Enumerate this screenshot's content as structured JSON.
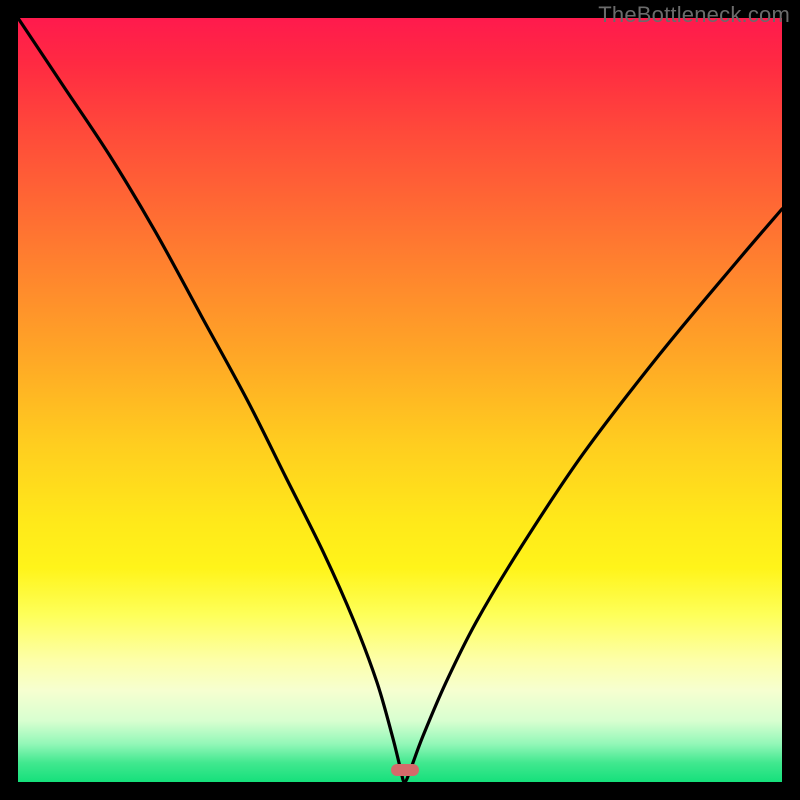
{
  "attribution": "TheBottleneck.com",
  "marker": {
    "x_pct": 50.6,
    "y_pct": 98.4
  },
  "colors": {
    "frame": "#000000",
    "curve": "#000000",
    "marker": "#d46a6a",
    "attribution_text": "#6b6b6b"
  },
  "chart_data": {
    "type": "line",
    "title": "",
    "xlabel": "",
    "ylabel": "",
    "xlim": [
      0,
      100
    ],
    "ylim": [
      0,
      100
    ],
    "grid": false,
    "legend": false,
    "series": [
      {
        "name": "bottleneck-curve",
        "x": [
          0,
          6,
          12,
          18,
          24,
          30,
          35,
          40,
          44,
          47,
          49,
          50,
          50.6,
          51.5,
          53,
          56,
          60,
          66,
          74,
          84,
          94,
          100
        ],
        "values": [
          100,
          91,
          82,
          72,
          61,
          50,
          40,
          30,
          21,
          13,
          6,
          2,
          0,
          2,
          6,
          13,
          21,
          31,
          43,
          56,
          68,
          75
        ]
      }
    ],
    "marker": {
      "x": 50.6,
      "y": 0
    },
    "background_gradient": "red-yellow-green vertical (low y = green = no bottleneck)"
  }
}
